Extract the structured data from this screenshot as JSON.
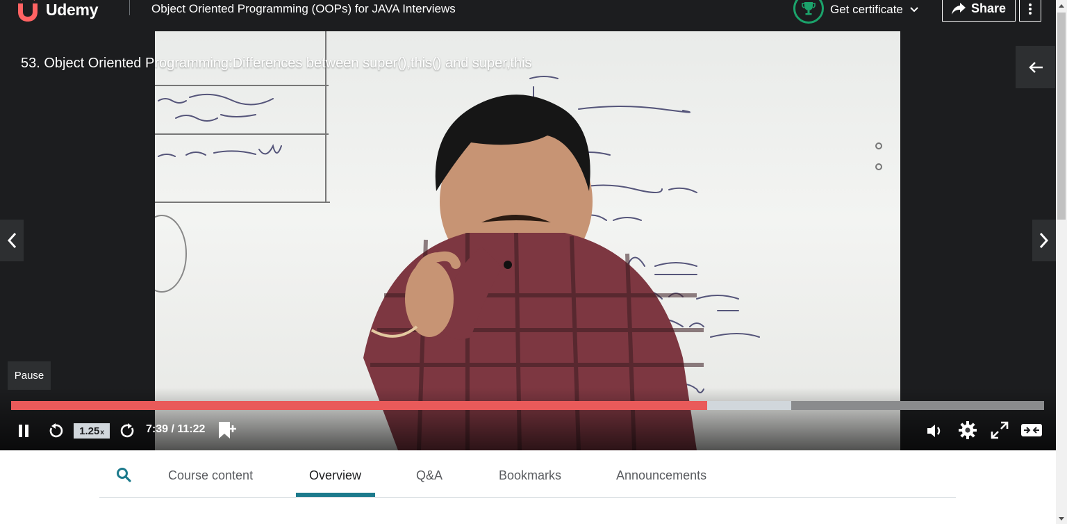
{
  "header": {
    "logo_text": "Udemy",
    "course_title": "Object Oriented Programming (OOPs) for JAVA Interviews",
    "certificate_label": "Get certificate",
    "share_label": "Share",
    "icons": {
      "logo": "udemy-logo-icon",
      "certificate": "trophy-icon",
      "dropdown": "chevron-down-icon",
      "share": "share-arrow-icon",
      "more": "more-vertical-icon"
    },
    "colors": {
      "bar_bg": "#1c1d1f",
      "trophy_ring": "#1ba36b",
      "logo": "#a435f0"
    }
  },
  "video": {
    "lecture_title": "53. Object Oriented Programming:Differences between super(),this() and super,this",
    "tooltip": "Pause",
    "playback_speed": "1.25",
    "speed_suffix": "x",
    "time_display": "7:39 / 11:22",
    "progress": {
      "played_fraction": 0.674,
      "buffered_fraction": 0.755
    },
    "colors": {
      "played": "#e95a5a",
      "buffered": "#d1d7dc",
      "track": "#8a8b8d"
    },
    "icons": {
      "back": "arrow-left-icon",
      "prev": "chevron-left-icon",
      "next": "chevron-right-icon",
      "pause": "pause-icon",
      "rewind": "rewind-5-icon",
      "forward": "forward-5-icon",
      "bookmark": "add-bookmark-icon",
      "volume": "volume-icon",
      "settings": "gear-icon",
      "fullscreen": "fullscreen-icon",
      "theater": "expand-theater-icon"
    }
  },
  "tabs": {
    "items": [
      {
        "label": "Course content"
      },
      {
        "label": "Overview"
      },
      {
        "label": "Q&A"
      },
      {
        "label": "Bookmarks"
      },
      {
        "label": "Announcements"
      }
    ],
    "active": "Overview",
    "search_icon": "search-icon",
    "accent_color": "#1c7a8c"
  }
}
